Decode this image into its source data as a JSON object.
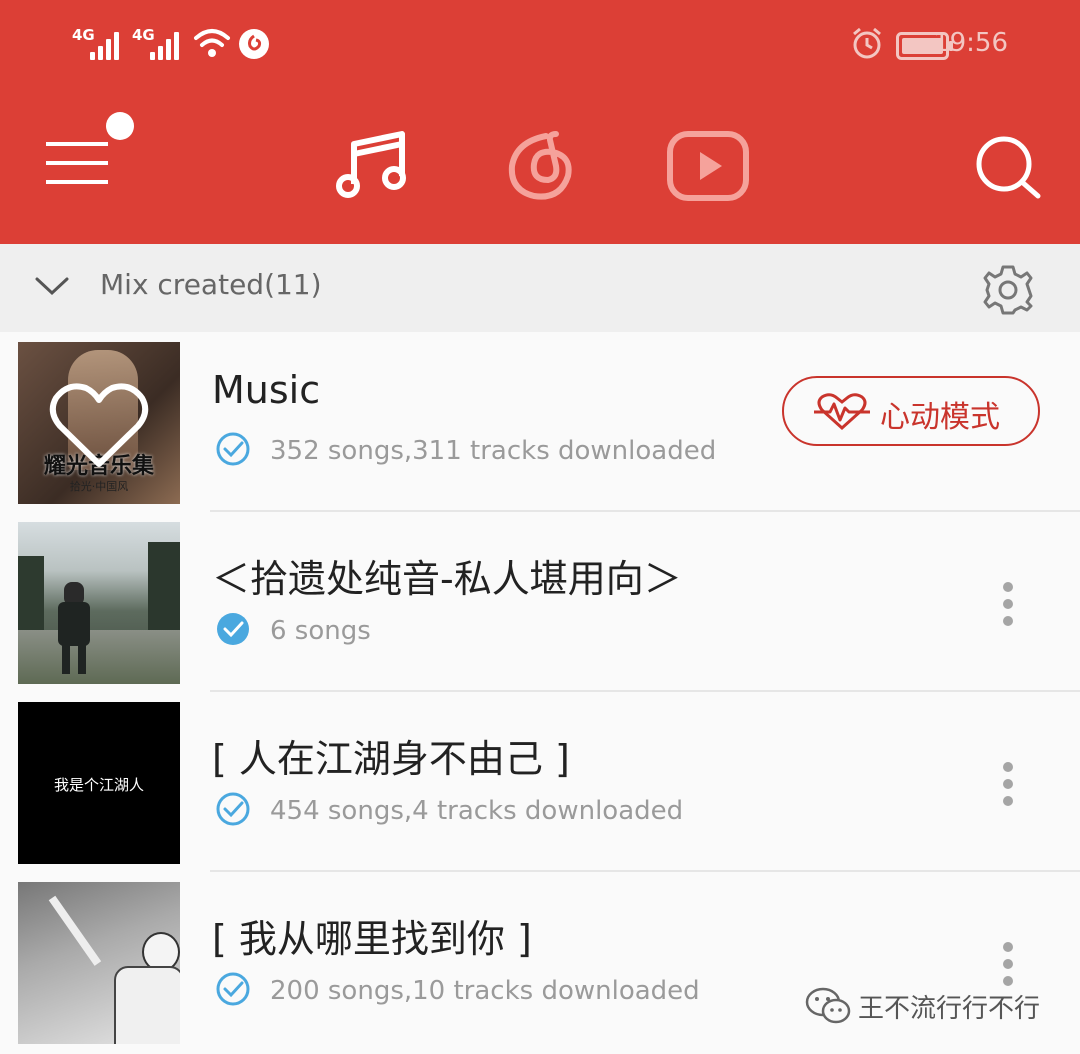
{
  "status_bar": {
    "signal1": "4G",
    "signal2": "4G",
    "time": "19:56"
  },
  "header": {
    "tabs": [
      "music-note-icon",
      "netease-logo-icon",
      "video-play-icon"
    ],
    "search_icon": "search-icon",
    "menu_icon": "hamburger-menu-icon"
  },
  "section": {
    "title": "Mix created(11)"
  },
  "playlists": [
    {
      "title": "Music",
      "meta": "352 songs,311 tracks downloaded",
      "cover_title": "耀光音乐集",
      "cover_sub": "拾光·中国风",
      "action_label": "心动模式"
    },
    {
      "title": "＜拾遗处纯音-私人堪用向＞",
      "meta": "6 songs"
    },
    {
      "title": "[ 人在江湖身不由己 ]",
      "meta": "454 songs,4 tracks downloaded",
      "cover_text": "我是个江湖人"
    },
    {
      "title": "[ 我从哪里找到你 ]",
      "meta": "200 songs,10 tracks downloaded"
    }
  ],
  "watermark": {
    "text": "王不流行行不行"
  },
  "colors": {
    "brand": "#dc3f36",
    "check": "#4aa8df"
  }
}
